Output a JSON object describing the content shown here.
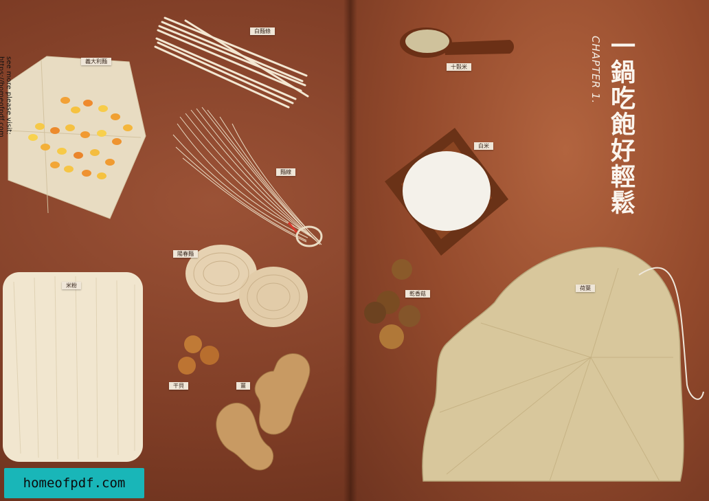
{
  "watermark": {
    "side_text": "see more please visit: https://homeofpdf.com",
    "badge_text": "homeofpdf.com"
  },
  "chapter": {
    "label": "CHAPTER 1.",
    "title": "一鍋吃飽好輕鬆"
  },
  "ingredients": {
    "pasta": "義大利麵",
    "white_noodle": "白麵條",
    "thin_noodle": "麵線",
    "yangchun_noodle": "陽春麵",
    "rice_vermicelli": "米粉",
    "scallop": "干貝",
    "ginger": "薑",
    "grains": "十穀米",
    "white_rice": "白米",
    "shiitake": "乾香菇",
    "lotus_leaf": "荷葉"
  },
  "colors": {
    "background": "#8a4429",
    "label_bg": "#efe6d8",
    "badge_bg": "#19b6b8"
  }
}
